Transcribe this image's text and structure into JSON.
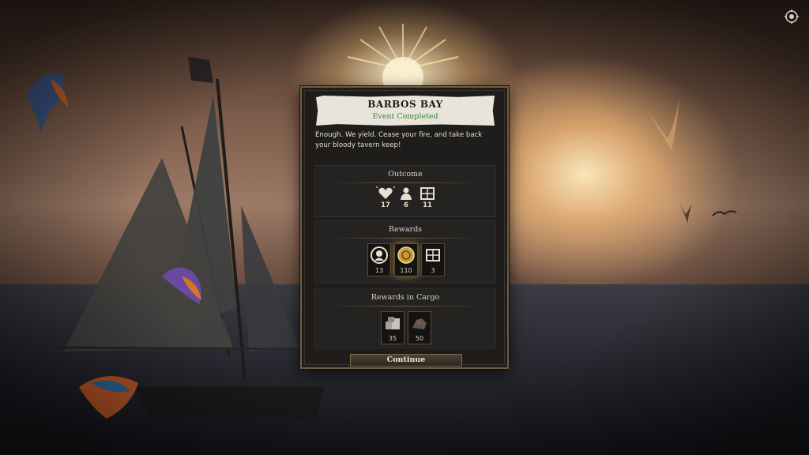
{
  "event": {
    "title": "BARBOS BAY",
    "status": "Event Completed",
    "narrative": "Enough. We yield. Cease your fire, and take back your bloody tavern keep!"
  },
  "outcome": {
    "title": "Outcome",
    "stats": [
      {
        "icon": "heart-icon",
        "value": "17"
      },
      {
        "icon": "crew-icon",
        "value": "6"
      },
      {
        "icon": "cargo-crate-icon",
        "value": "11"
      }
    ]
  },
  "rewards": {
    "title": "Rewards",
    "items": [
      {
        "icon": "reputation-icon",
        "count": "13"
      },
      {
        "icon": "gold-coin-icon",
        "count": "110"
      },
      {
        "icon": "supplies-crate-icon",
        "count": "3"
      }
    ]
  },
  "cargo": {
    "title": "Rewards in Cargo",
    "items": [
      {
        "icon": "stone-blocks-icon",
        "count": "35"
      },
      {
        "icon": "ore-icon",
        "count": "50"
      }
    ]
  },
  "continue_label": "Continue",
  "colors": {
    "status_green": "#2f8a2c",
    "panel": "#1e1d1c",
    "frame_gold": "#6d5d45"
  }
}
